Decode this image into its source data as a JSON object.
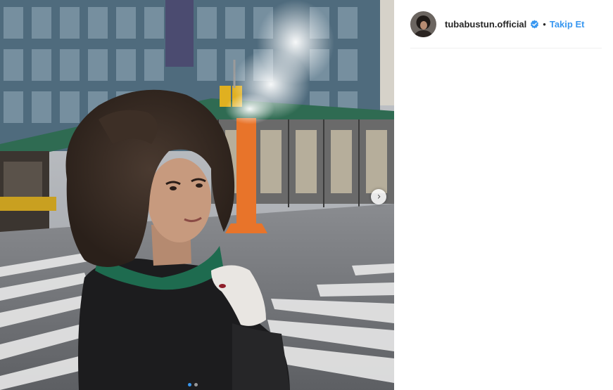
{
  "post": {
    "username": "tubabustun.official",
    "separator": "•",
    "follow_label": "Takip Et",
    "verified": true,
    "carousel": {
      "current": 1,
      "total": 2
    }
  },
  "icons": {
    "verified": "verified-badge-icon",
    "next": "chevron-right-icon"
  },
  "colors": {
    "accent": "#3897f0",
    "username": "#262626",
    "divider": "#efefef"
  }
}
